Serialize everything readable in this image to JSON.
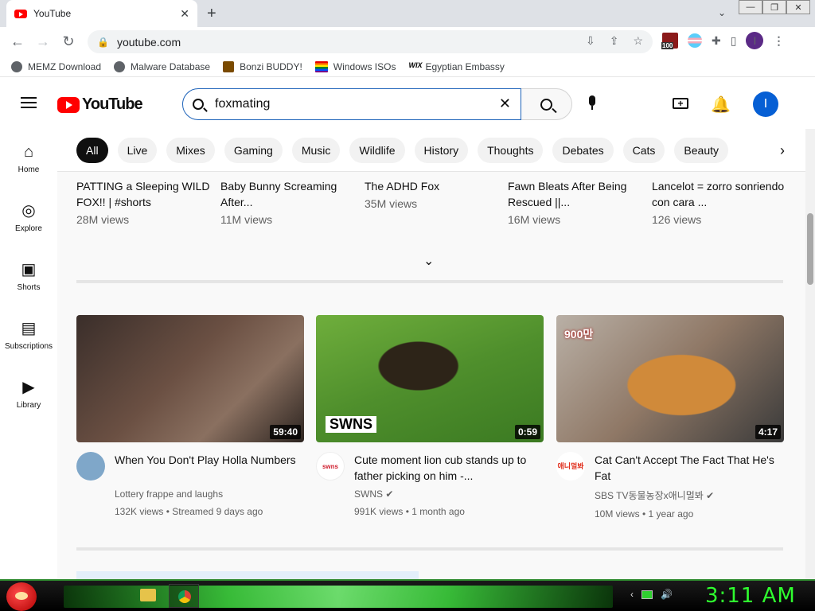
{
  "browser": {
    "tab_title": "YouTube",
    "tab_close": "✕",
    "new_tab": "+",
    "url": "youtube.com",
    "window_controls": [
      "—",
      "❐",
      "✕"
    ],
    "extension_badge": "100",
    "profile_initial": "I"
  },
  "bookmarks": [
    {
      "label": "MEMZ Download",
      "icon": "globe-icon"
    },
    {
      "label": "Malware Database",
      "icon": "globe-icon"
    },
    {
      "label": "Bonzi BUDDY!",
      "icon": "bonzi-icon"
    },
    {
      "label": "Windows ISOs",
      "icon": "rainbow-flag-icon"
    },
    {
      "label": "Egyptian Embassy",
      "icon": "wix-icon"
    }
  ],
  "youtube": {
    "logo_text": "YouTube",
    "search_value": "foxmating",
    "avatar_initial": "I"
  },
  "sidebar": [
    {
      "label": "Home",
      "icon": "home-icon",
      "glyph": "⌂"
    },
    {
      "label": "Explore",
      "icon": "compass-icon",
      "glyph": "◎"
    },
    {
      "label": "Shorts",
      "icon": "shorts-icon",
      "glyph": "▣"
    },
    {
      "label": "Subscriptions",
      "icon": "subscriptions-icon",
      "glyph": "▤"
    },
    {
      "label": "Library",
      "icon": "library-icon",
      "glyph": "▶"
    }
  ],
  "chips": [
    "All",
    "Live",
    "Mixes",
    "Gaming",
    "Music",
    "Wildlife",
    "History",
    "Thoughts",
    "Debates",
    "Cats",
    "Beauty"
  ],
  "shorts": [
    {
      "title": "PATTING a Sleeping WILD FOX!! | #shorts",
      "views": "28M views"
    },
    {
      "title": "Baby Bunny Screaming After...",
      "views": "11M views"
    },
    {
      "title": "The ADHD Fox",
      "views": "35M views"
    },
    {
      "title": "Fawn Bleats After Being Rescued ||...",
      "views": "16M views"
    },
    {
      "title": "Lancelot = zorro sonriendo con cara ...",
      "views": "126 views"
    }
  ],
  "videos": [
    {
      "title": "When You Don't Play Holla Numbers",
      "channel": "Lottery frappe and laughs",
      "stats": "132K views • Streamed 9 days ago",
      "duration": "59:40",
      "thumb_color": "#6b5043",
      "avatar_color": "#7fa7c9"
    },
    {
      "title": "Cute moment lion cub stands up to father picking on him -...",
      "channel": "SWNS",
      "stats": "991K views • 1 month ago",
      "duration": "0:59",
      "thumb_color": "#4f8f2c",
      "avatar_color": "#ffffff",
      "overlay": "SWNS",
      "avatar_text": "swns"
    },
    {
      "title": "Cat Can't Accept The Fact That He's Fat",
      "channel": "SBS TV동물농장x애니멀봐",
      "stats": "10M views • 1 year ago",
      "duration": "4:17",
      "thumb_color": "#8f7866",
      "avatar_color": "#ffffff",
      "overlay": "900만",
      "avatar_text": "애니멀봐"
    }
  ],
  "taskbar": {
    "clock": "3:11 AM"
  },
  "colors": {
    "youtube_red": "#ff0000",
    "link_blue": "#065fd4",
    "taskbar_green": "#2fff2f"
  }
}
